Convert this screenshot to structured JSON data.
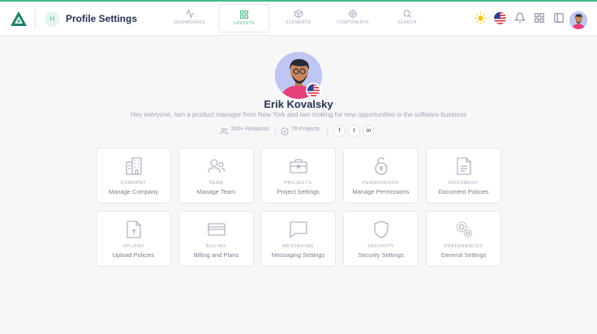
{
  "header": {
    "badge_letter": "H",
    "title": "Profile Settings",
    "tabs": [
      {
        "label": "Dashboards",
        "icon": "activity-icon",
        "active": false
      },
      {
        "label": "Layouts",
        "icon": "grid-icon",
        "active": true
      },
      {
        "label": "Elements",
        "icon": "box-icon",
        "active": false
      },
      {
        "label": "Components",
        "icon": "settings-icon",
        "active": false
      },
      {
        "label": "Search",
        "icon": "search-icon",
        "active": false
      }
    ]
  },
  "profile": {
    "name": "Erik Kovalsky",
    "bio": "Hey everyone, Iam a product manager from New York and Iam looking for new opportunities in the software business",
    "relations": "500+ Relations",
    "projects": "78 Projects",
    "social": [
      "f",
      "t",
      "in"
    ]
  },
  "cards": [
    {
      "title": "Company",
      "subtitle": "Manage Company",
      "icon": "building-icon"
    },
    {
      "title": "Team",
      "subtitle": "Manage Team",
      "icon": "users-icon"
    },
    {
      "title": "Projects",
      "subtitle": "Project Settings",
      "icon": "briefcase-icon"
    },
    {
      "title": "Permissions",
      "subtitle": "Manage Permissions",
      "icon": "unlock-icon"
    },
    {
      "title": "Document",
      "subtitle": "Document Policies",
      "icon": "document-icon"
    },
    {
      "title": "Upload",
      "subtitle": "Upload Policies",
      "icon": "upload-file-icon"
    },
    {
      "title": "Billing",
      "subtitle": "Billing and Plans",
      "icon": "credit-card-icon"
    },
    {
      "title": "Messaging",
      "subtitle": "Messaging Settings",
      "icon": "message-icon"
    },
    {
      "title": "Security",
      "subtitle": "Security Settings",
      "icon": "shield-icon"
    },
    {
      "title": "Preferences",
      "subtitle": "General Settings",
      "icon": "gears-icon"
    }
  ],
  "colors": {
    "accent": "#41b983",
    "text": "#283252",
    "muted": "#a2a5b9",
    "background": "#f7f7f8"
  }
}
